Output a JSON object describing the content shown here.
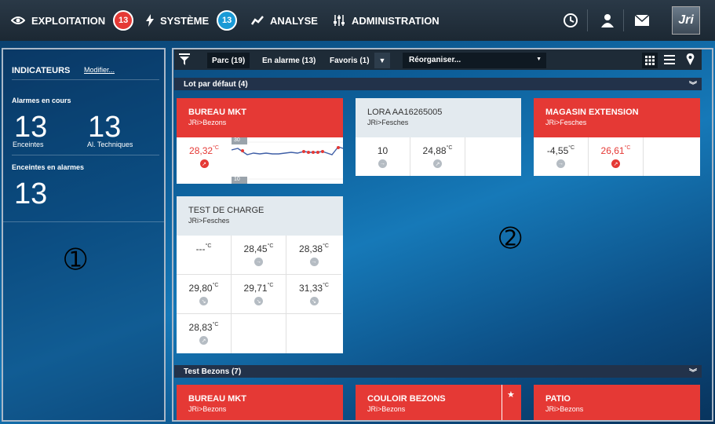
{
  "nav": {
    "exploitation": "EXPLOITATION",
    "exploitation_count": "13",
    "systeme": "SYSTÈME",
    "systeme_count": "13",
    "analyse": "ANALYSE",
    "administration": "ADMINISTRATION",
    "logo": "Jri"
  },
  "left": {
    "title": "INDICATEURS",
    "modify": "Modifier...",
    "alarms_label": "Alarmes en cours",
    "enceintes_value": "13",
    "enceintes_label": "Enceintes",
    "techniques_value": "13",
    "techniques_label": "Al. Techniques",
    "enc_alarm_label": "Enceintes en alarmes",
    "enc_alarm_value": "13",
    "marker": "➀"
  },
  "toolbar": {
    "parc": "Parc (19)",
    "en_alarme": "En alarme (13)",
    "favoris": "Favoris (1)",
    "reorganiser": "Réorganiser..."
  },
  "main": {
    "marker": "➁"
  },
  "group1": {
    "label": "Lot par défaut (4)"
  },
  "group2": {
    "label": "Test Bezons (7)"
  },
  "cards": {
    "c1": {
      "title": "BUREAU MKT",
      "sub": "JRi>Bezons",
      "value": "28,32",
      "unit": "°C",
      "chart_max": "30",
      "chart_min": "10"
    },
    "c2": {
      "title": "LORA AA16265005",
      "sub": "JRi>Fesches",
      "v1": "10",
      "v2": "24,88",
      "unit": "°C"
    },
    "c3": {
      "title": "MAGASIN EXTENSION",
      "sub": "JRi>Fesches",
      "v1": "-4,55",
      "v2": "26,61",
      "unit": "°C"
    },
    "c4": {
      "title": "TEST DE CHARGE",
      "sub": "JRi>Fesches",
      "v1": "---",
      "v2": "28,45",
      "v3": "28,38",
      "v4": "29,80",
      "v5": "29,71",
      "v6": "31,33",
      "v7": "28,83",
      "unit": "°C"
    },
    "c5": {
      "title": "BUREAU MKT",
      "sub": "JRi>Bezons"
    },
    "c6": {
      "title": "COULOIR BEZONS",
      "sub": "JRi>Bezons",
      "star": "★"
    },
    "c7": {
      "title": "PATIO",
      "sub": "JRi>Bezons"
    }
  },
  "colors": {
    "alarm_red": "#e53935",
    "badge_red": "#e53935",
    "badge_blue": "#1a9ad6"
  }
}
